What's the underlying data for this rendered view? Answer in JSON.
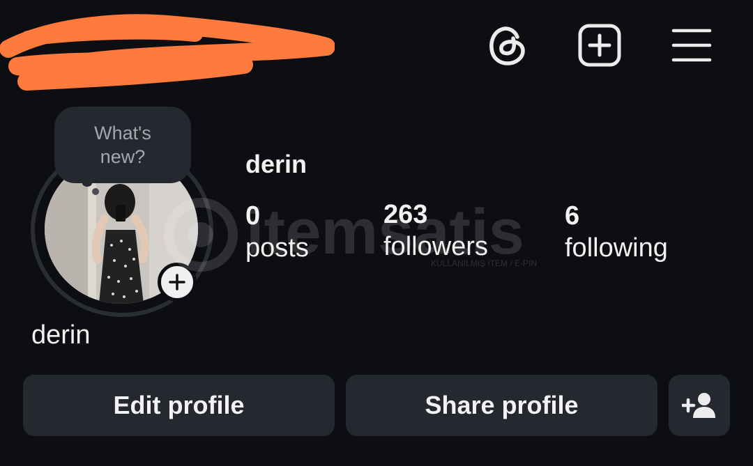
{
  "header": {
    "threads_icon": "threads-icon",
    "create_icon": "plus-square-icon",
    "menu_icon": "hamburger-menu-icon"
  },
  "story_bubble": {
    "text": "What's new?"
  },
  "profile": {
    "username": "derin",
    "display_name": "derin",
    "stats": [
      {
        "value": "0",
        "label": "posts"
      },
      {
        "value": "263",
        "label": "followers"
      },
      {
        "value": "6",
        "label": "following"
      }
    ]
  },
  "actions": {
    "edit_label": "Edit profile",
    "share_label": "Share profile",
    "discover_icon": "add-person-icon"
  },
  "watermark": {
    "text": "itemsatis",
    "subtext": "KULLANILMIŞ ITEM / E-PIN"
  },
  "colors": {
    "background": "#0c0e12",
    "button": "#25282e",
    "text": "#f2f2f2",
    "redaction": "#ff7a3d"
  }
}
